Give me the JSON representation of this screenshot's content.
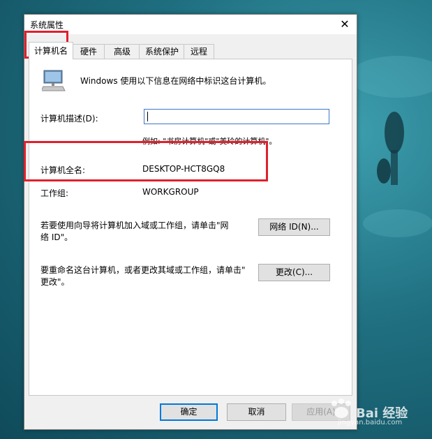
{
  "window": {
    "title": "系统属性",
    "close_glyph": "✕"
  },
  "tabs": [
    {
      "label": "计算机名"
    },
    {
      "label": "硬件"
    },
    {
      "label": "高级"
    },
    {
      "label": "系统保护"
    },
    {
      "label": "远程"
    }
  ],
  "panel": {
    "intro": "Windows 使用以下信息在网络中标识这台计算机。",
    "description_label": "计算机描述(D):",
    "description_value": "",
    "example": "例如: \"书房计算机\"或\"美玲的计算机\"。",
    "full_name_label": "计算机全名:",
    "full_name_value": "DESKTOP-HCT8GQ8",
    "workgroup_label": "工作组:",
    "workgroup_value": "WORKGROUP",
    "join_text_line1": "若要使用向导将计算机加入域或工作组，请单击\"网",
    "join_text_line2": "络 ID\"。",
    "network_id_button": "网络 ID(N)...",
    "rename_text_line1": "要重命名这台计算机，或者更改其域或工作组，请单击\"",
    "rename_text_line2": "更改\"。",
    "change_button": "更改(C)..."
  },
  "footer": {
    "ok": "确定",
    "cancel": "取消",
    "apply": "应用(A)"
  },
  "watermark": {
    "text": "Bai 经验",
    "url": "jingyan.baidu.com"
  },
  "colors": {
    "highlight": "#e0202c",
    "focus": "#0078d7"
  }
}
